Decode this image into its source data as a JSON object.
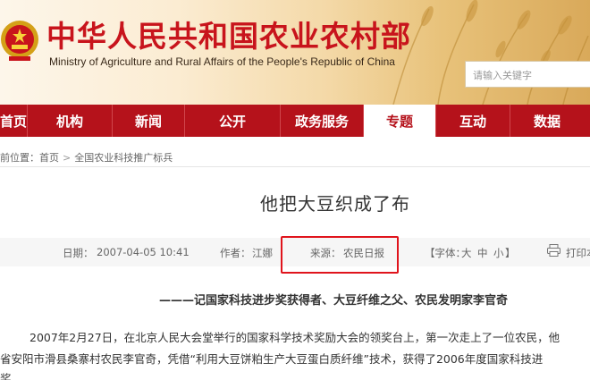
{
  "header": {
    "site_title": "中华人民共和国农业农村部",
    "site_subtitle": "Ministry of Agriculture and Rural Affairs of the People's Republic of China",
    "search_placeholder": "请输入关键字",
    "emblem_icon": "national-emblem-icon",
    "colors": {
      "brand_red": "#c8141c",
      "nav_red": "#b5121b"
    }
  },
  "nav": {
    "items": [
      {
        "label": "首页"
      },
      {
        "label": "机构"
      },
      {
        "label": "新闻"
      },
      {
        "label": "公开"
      },
      {
        "label": "政务服务"
      },
      {
        "label": "专题",
        "active": true
      },
      {
        "label": "互动"
      },
      {
        "label": "数据"
      }
    ]
  },
  "breadcrumb": {
    "prefix": "前位置：",
    "home": "首页",
    "arrow": ">",
    "current": "全国农业科技推广标兵"
  },
  "article": {
    "title": "他把大豆织成了布",
    "meta": {
      "date_label": "日期：",
      "date": "2007-04-05 10:41",
      "author_label": "作者：",
      "author": "江娜",
      "source_label": "来源：",
      "source": "农民日报",
      "font_label": "【字体：",
      "font_large": "大",
      "font_medium": "中",
      "font_small": "小",
      "font_close": "】",
      "print_label": "打印本"
    },
    "subtitle": "———记国家科技进步奖获得者、大豆纤维之父、农民发明家李官奇",
    "paragraphs": [
      "2007年2月27日，在北京人民大会堂举行的国家科学技术奖励大会的领奖台上，第一次走上了一位农民，他",
      "省安阳市滑县桑寨村农民李官奇，凭借“利用大豆饼粕生产大豆蛋白质纤维”技术，获得了2006年度国家科技进",
      "奖"
    ]
  }
}
